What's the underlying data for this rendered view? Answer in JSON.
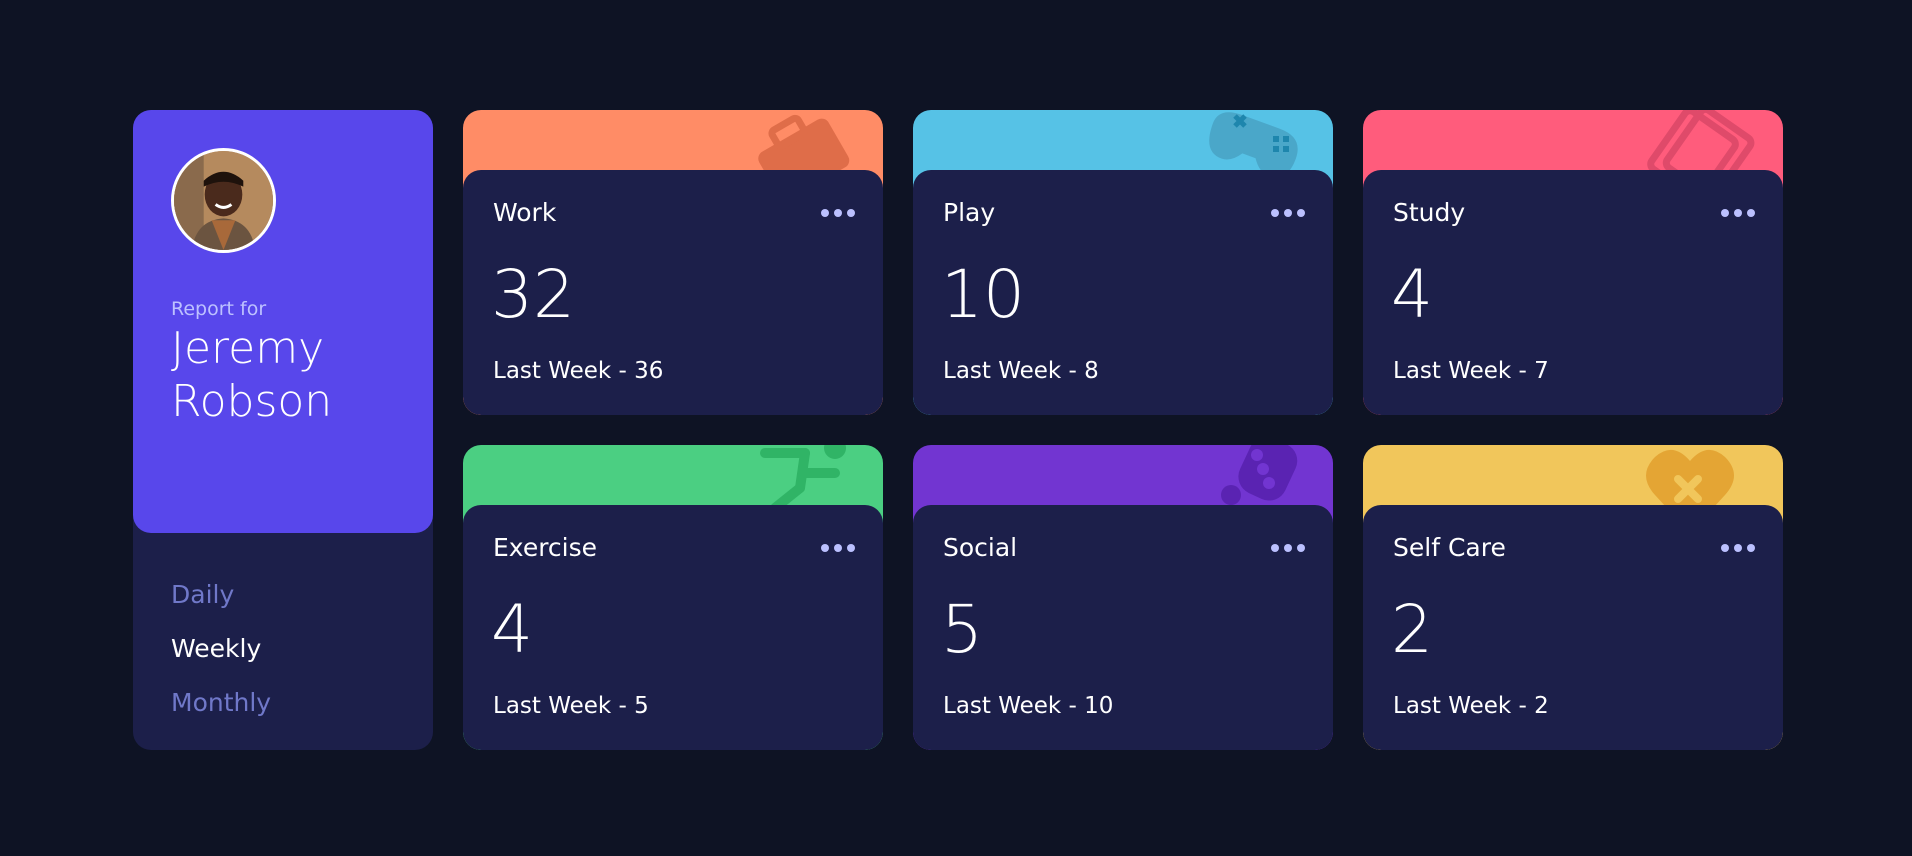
{
  "profile": {
    "report_for": "Report for",
    "name": "Jeremy Robson"
  },
  "periods": [
    "Daily",
    "Weekly",
    "Monthly"
  ],
  "active_period": "Weekly",
  "colors": {
    "background": "#0e1324",
    "card_body": "#1c1f4a",
    "profile": "#5847eb",
    "work": "#ff8c66",
    "play": "#56c2e6",
    "study": "#ff5c7c",
    "exercise": "#4bcf82",
    "social": "#7235d1",
    "self_care": "#f1c65b"
  },
  "activities": [
    {
      "title": "Work",
      "current": "32",
      "previous": "Last Week - 36",
      "icon": "briefcase-icon",
      "color": "#ff8c66"
    },
    {
      "title": "Play",
      "current": "10",
      "previous": "Last Week - 8",
      "icon": "gamepad-icon",
      "color": "#56c2e6"
    },
    {
      "title": "Study",
      "current": "4",
      "previous": "Last Week - 7",
      "icon": "book-icon",
      "color": "#ff5c7c"
    },
    {
      "title": "Exercise",
      "current": "4",
      "previous": "Last Week - 5",
      "icon": "running-icon",
      "color": "#4bcf82"
    },
    {
      "title": "Social",
      "current": "5",
      "previous": "Last Week - 10",
      "icon": "social-icon",
      "color": "#7235d1"
    },
    {
      "title": "Self Care",
      "current": "2",
      "previous": "Last Week - 2",
      "icon": "heart-icon",
      "color": "#f1c65b"
    }
  ]
}
